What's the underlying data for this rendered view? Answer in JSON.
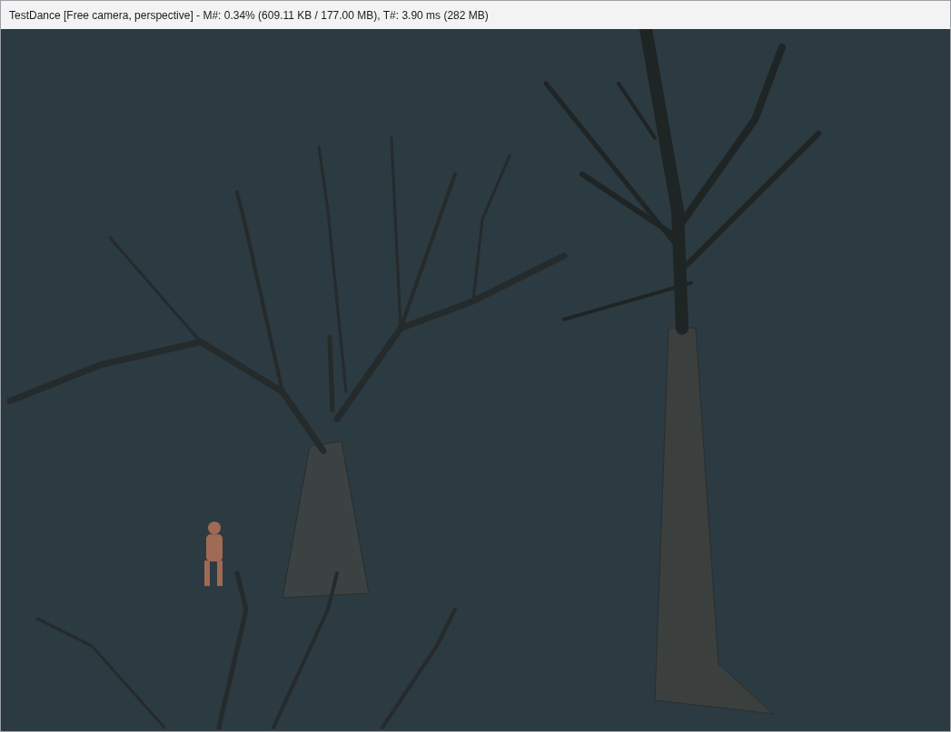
{
  "window": {
    "title": "TestDance [Free camera, perspective] - M#: 0.34% (609.11 KB / 177.00 MB), T#: 3.90 ms (282 MB)"
  }
}
